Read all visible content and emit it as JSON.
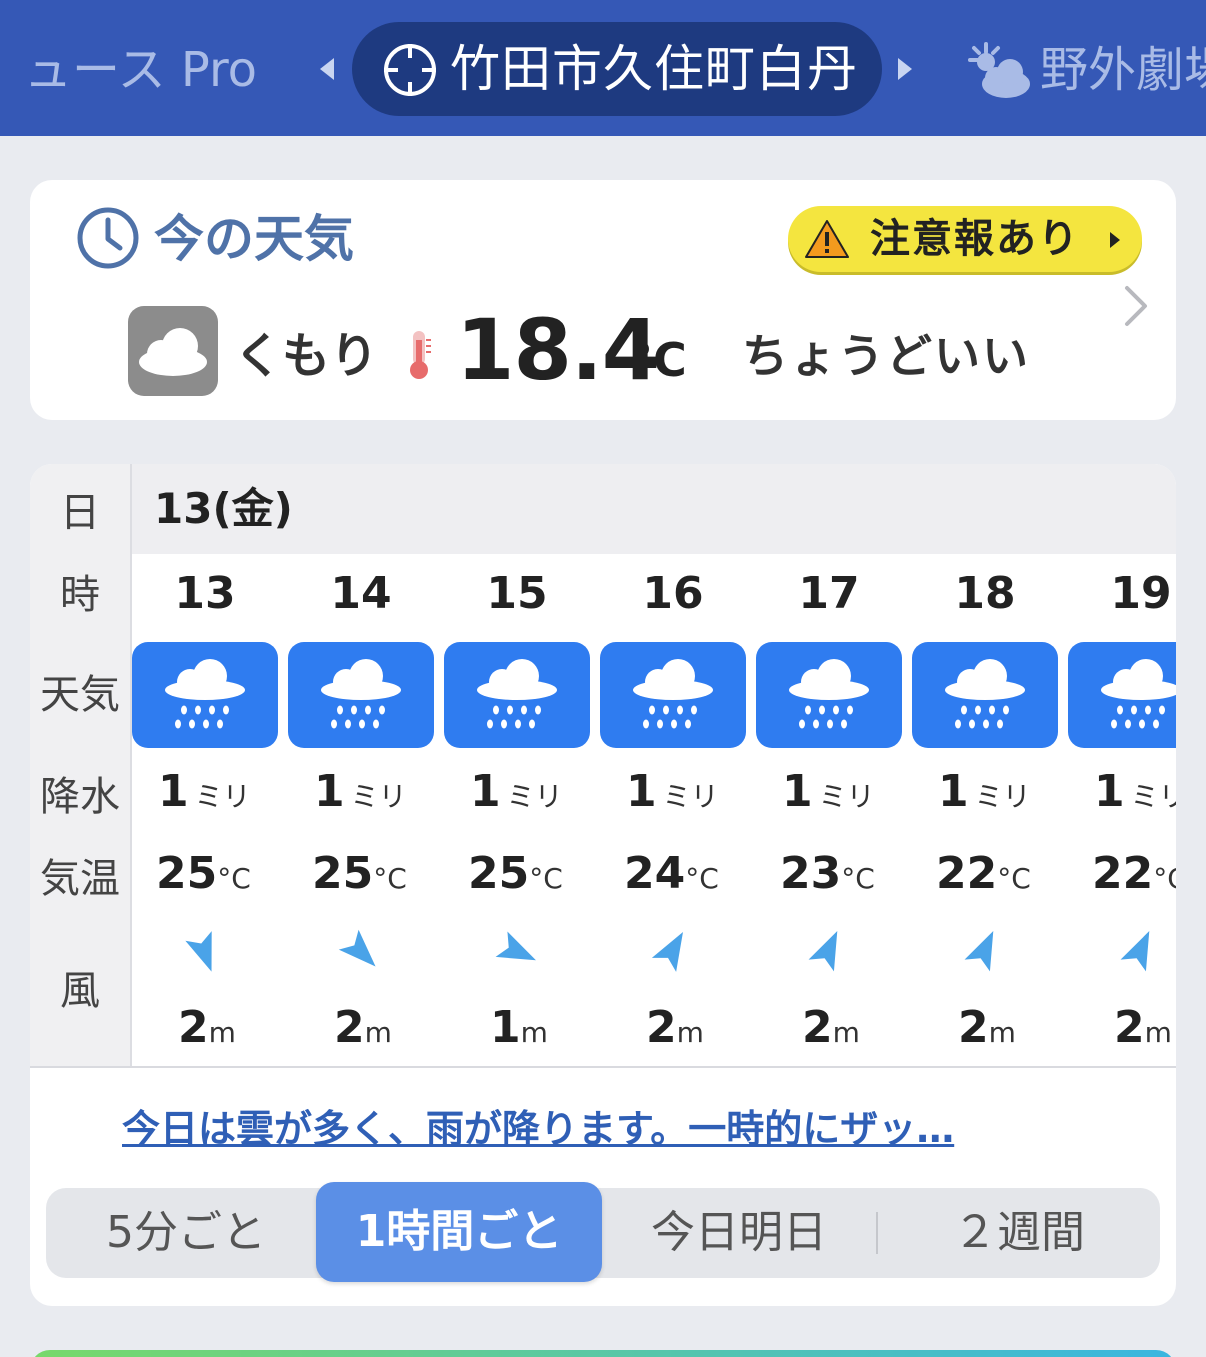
{
  "topbar": {
    "prev_tab": "ュース Pro",
    "current_location": "竹田市久住町白丹",
    "next_tab": "野外劇場",
    "next_tab_icon": "partly-cloudy-icon",
    "current_icon": "location-target-icon"
  },
  "now": {
    "title": "今の天気",
    "alert": "注意報あり",
    "condition": "くもり",
    "temperature": "18.4",
    "unit": "°C",
    "feel": "ちょうどいい",
    "condition_icon": "cloud-icon"
  },
  "hourly": {
    "row_labels": [
      "日",
      "時",
      "天気",
      "降水",
      "気温",
      "風"
    ],
    "date": "13(金)",
    "rain_unit": "ミリ",
    "temp_unit": "°C",
    "wind_unit": "m",
    "hours": [
      {
        "hour": "13",
        "weather": "rain-icon",
        "rain": "1",
        "temp": "25",
        "wind_dir_deg": 250,
        "wind": "2"
      },
      {
        "hour": "14",
        "weather": "rain-icon",
        "rain": "1",
        "temp": "25",
        "wind_dir_deg": 225,
        "wind": "2"
      },
      {
        "hour": "15",
        "weather": "rain-icon",
        "rain": "1",
        "temp": "25",
        "wind_dir_deg": 205,
        "wind": "1"
      },
      {
        "hour": "16",
        "weather": "rain-icon",
        "rain": "1",
        "temp": "24",
        "wind_dir_deg": 120,
        "wind": "2"
      },
      {
        "hour": "17",
        "weather": "rain-icon",
        "rain": "1",
        "temp": "23",
        "wind_dir_deg": 115,
        "wind": "2"
      },
      {
        "hour": "18",
        "weather": "rain-icon",
        "rain": "1",
        "temp": "22",
        "wind_dir_deg": 115,
        "wind": "2"
      },
      {
        "hour": "19",
        "weather": "rain-icon",
        "rain": "1",
        "temp": "22",
        "wind_dir_deg": 115,
        "wind": "2"
      }
    ],
    "summary": "今日は雲が多く、雨が降ります。一時的にザッ…",
    "segments": [
      "5分ごと",
      "1時間ごと",
      "今日明日",
      "２週間"
    ],
    "active_segment": 1
  },
  "colors": {
    "topbar": "#3558b6",
    "tile": "#2f7cf0",
    "alert": "#f4e53f",
    "wind_arrow": "#4aa3e8",
    "active_segment": "#5b8fe6"
  }
}
